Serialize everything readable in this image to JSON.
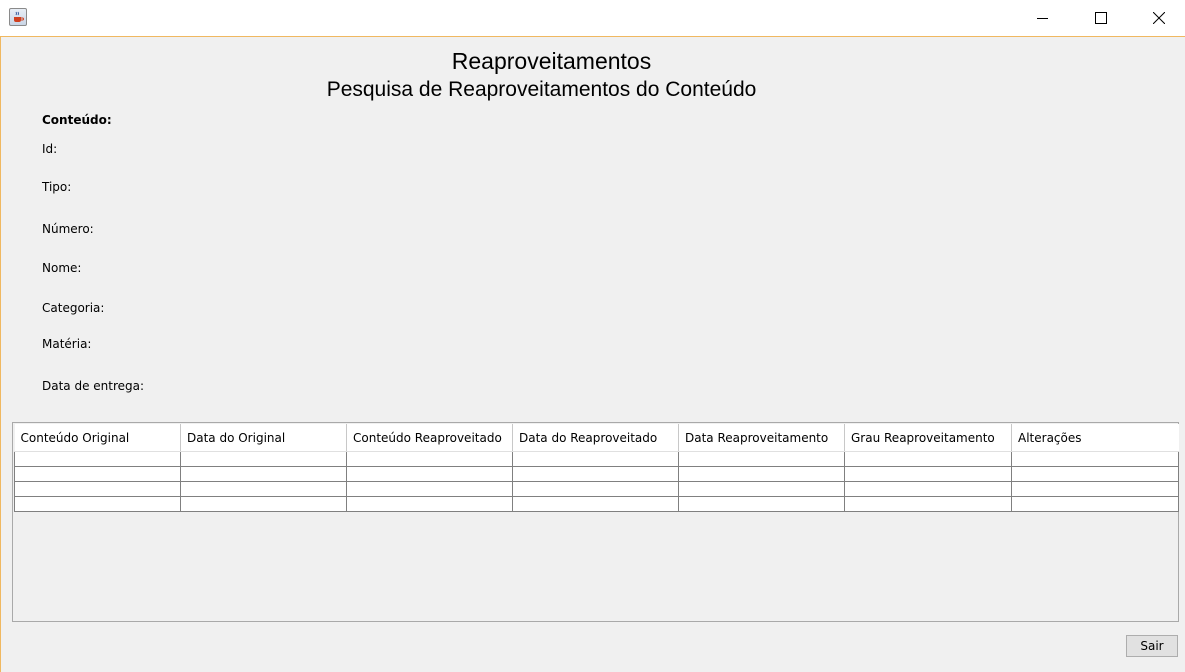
{
  "window": {
    "controls": {
      "minimize_icon": "minimize-icon",
      "maximize_icon": "maximize-icon",
      "close_icon": "close-icon"
    },
    "app_icon": "java-cup-icon",
    "accent_color": "#f0b860"
  },
  "header": {
    "title": "Reaproveitamentos",
    "subtitle": "Pesquisa de Reaproveitamentos do Conteúdo"
  },
  "content_info": {
    "section_label": "Conteúdo:",
    "fields": [
      {
        "label": "Id:",
        "value": ""
      },
      {
        "label": "Tipo:",
        "value": ""
      },
      {
        "label": "Número:",
        "value": ""
      },
      {
        "label": "Nome:",
        "value": ""
      },
      {
        "label": "Categoria:",
        "value": ""
      },
      {
        "label": "Matéria:",
        "value": ""
      },
      {
        "label": "Data de entrega:",
        "value": ""
      }
    ]
  },
  "table": {
    "columns": [
      "Conteúdo Original",
      "Data do Original",
      "Conteúdo Reaproveitado",
      "Data do Reaproveitado",
      "Data Reaproveitamento",
      "Grau Reaproveitamento",
      "Alterações"
    ],
    "rows": [
      [
        "",
        "",
        "",
        "",
        "",
        "",
        ""
      ],
      [
        "",
        "",
        "",
        "",
        "",
        "",
        ""
      ],
      [
        "",
        "",
        "",
        "",
        "",
        "",
        ""
      ],
      [
        "",
        "",
        "",
        "",
        "",
        "",
        ""
      ]
    ]
  },
  "footer": {
    "exit_label": "Sair"
  }
}
